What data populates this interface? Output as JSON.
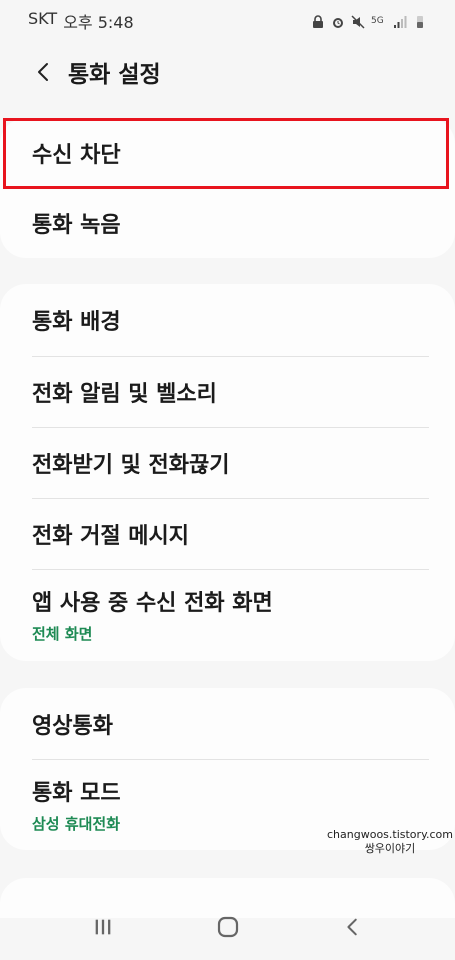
{
  "status_bar": {
    "carrier": "SKT",
    "time": "오후 5:48",
    "network_label": "5G"
  },
  "header": {
    "title": "통화 설정"
  },
  "card1": {
    "items": [
      {
        "title": "수신 차단"
      },
      {
        "title": "통화 녹음"
      }
    ]
  },
  "card2": {
    "items": [
      {
        "title": "통화 배경"
      },
      {
        "title": "전화 알림 및 벨소리"
      },
      {
        "title": "전화받기 및 전화끊기"
      },
      {
        "title": "전화 거절 메시지"
      },
      {
        "title": "앱 사용 중 수신 전화 화면",
        "subtitle": "전체 화면"
      }
    ]
  },
  "card3": {
    "items": [
      {
        "title": "영상통화"
      },
      {
        "title": "통화 모드",
        "subtitle": "삼성 휴대전화"
      }
    ]
  },
  "watermark": {
    "line1": "changwoos.tistory.com",
    "line2": "쌍우이야기"
  },
  "colors": {
    "accent_green": "#1e8a54",
    "highlight_red": "#e8141e",
    "background": "#f6f6f6"
  }
}
